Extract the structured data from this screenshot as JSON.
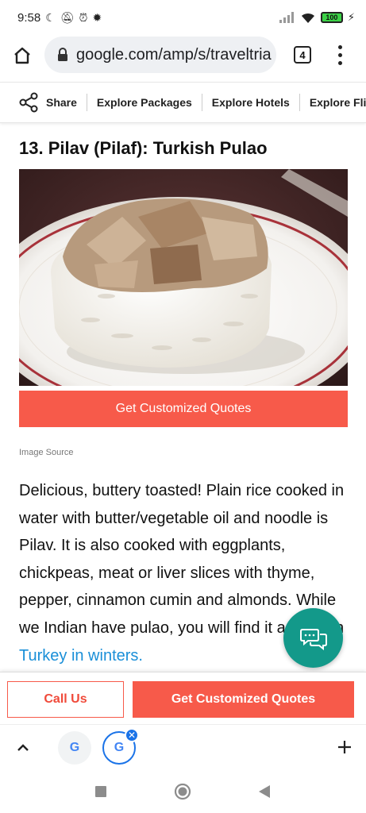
{
  "status_bar": {
    "time": "9:58",
    "battery": "100"
  },
  "browser": {
    "url": "google.com/amp/s/traveltria",
    "tab_count": "4"
  },
  "site_nav": {
    "share_label": "Share",
    "links": [
      "Explore Packages",
      "Explore Hotels",
      "Explore Flight"
    ]
  },
  "article": {
    "heading": "13. Pilav (Pilaf): Turkish Pulao",
    "cta_label": "Get Customized Quotes",
    "image_source_label": "Image Source",
    "body": "Delicious, buttery toasted! Plain rice cooked in water with butter/vegetable oil and noodle is Pilav. It is also cooked with eggplants, chickpeas, meat or liver slices with thyme, pepper, cinnamon cumin and almonds. While we Indian have pulao, you will find it as pilaf in ",
    "body_link": "Turkey in winters."
  },
  "cta_bar": {
    "call_label": "Call Us",
    "quotes_label": "Get Customized Quotes"
  },
  "tab_strip": {
    "tabs": [
      "G",
      "G"
    ]
  },
  "colors": {
    "accent": "#f75a4a",
    "link": "#1a8fd8",
    "chat": "#13998a",
    "tab_active": "#1a73e8"
  }
}
